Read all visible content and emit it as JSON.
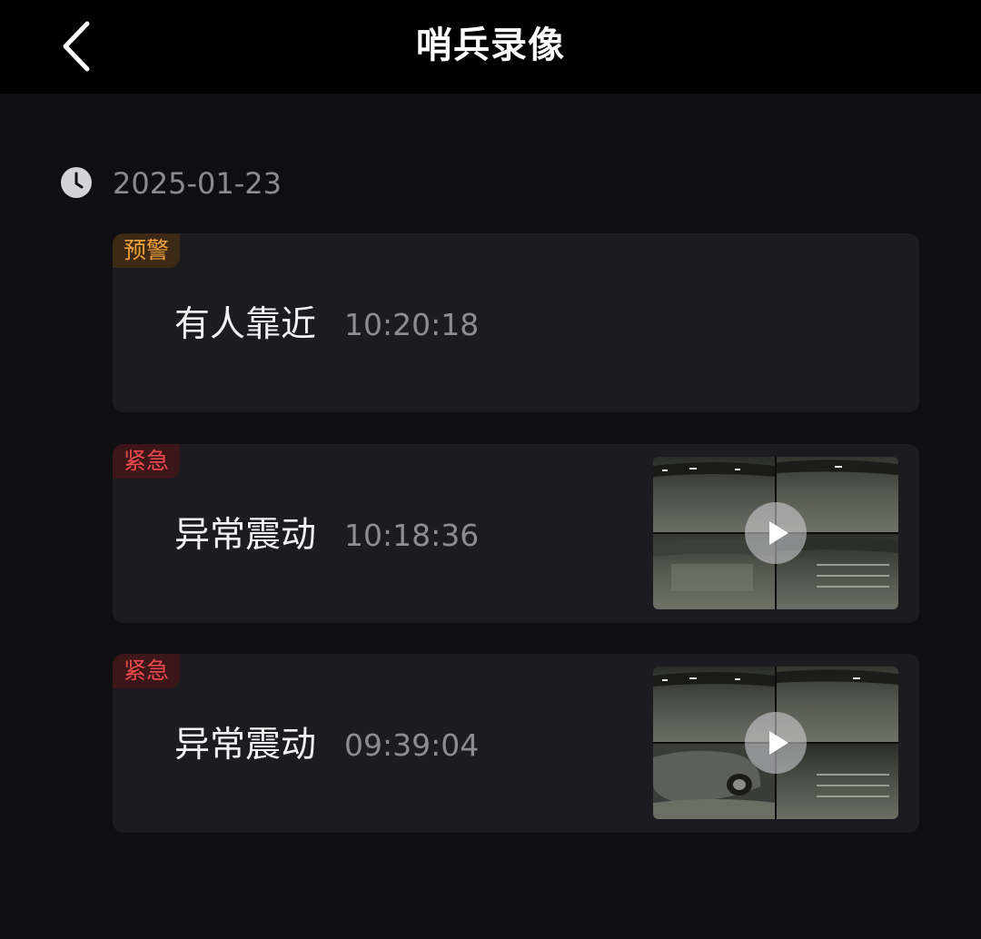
{
  "header": {
    "title": "哨兵录像",
    "back_icon": "chevron-left-icon"
  },
  "date_group": {
    "date": "2025-01-23",
    "icon": "clock-icon"
  },
  "records": [
    {
      "badge": "预警",
      "badge_type": "warning",
      "badge_color": "#f2a13b",
      "event": "有人靠近",
      "time": "10:20:18",
      "has_video": false
    },
    {
      "badge": "紧急",
      "badge_type": "urgent",
      "badge_color": "#ee4a4e",
      "event": "异常震动",
      "time": "10:18:36",
      "has_video": true,
      "play_icon": "play-icon"
    },
    {
      "badge": "紧急",
      "badge_type": "urgent",
      "badge_color": "#ee4a4e",
      "event": "异常震动",
      "time": "09:39:04",
      "has_video": true,
      "play_icon": "play-icon"
    }
  ],
  "colors": {
    "background": "#0f0f11",
    "header_background": "#000000",
    "card_background": "#1b1b20"
  }
}
